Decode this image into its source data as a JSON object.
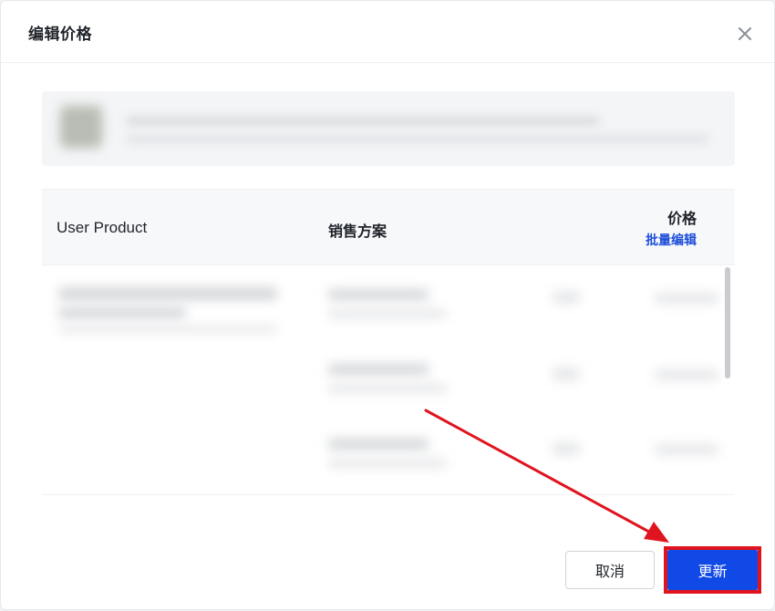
{
  "dialog": {
    "title": "编辑价格",
    "close_icon": "close-icon"
  },
  "table": {
    "columns": {
      "product": "User Product",
      "plan": "销售方案",
      "price": "价格",
      "batch_edit": "批量编辑"
    }
  },
  "footer": {
    "cancel_label": "取消",
    "update_label": "更新"
  },
  "colors": {
    "primary": "#1149e6",
    "link": "#1d4ed8",
    "annotation": "#e0141e"
  }
}
